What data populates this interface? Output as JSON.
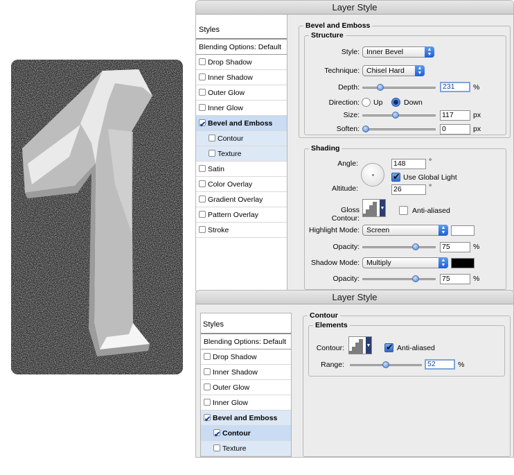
{
  "window1": {
    "title": "Layer Style",
    "sidebar": {
      "styles_label": "Styles",
      "blending_label": "Blending Options: Default",
      "items": [
        {
          "label": "Drop Shadow",
          "checked": false
        },
        {
          "label": "Inner Shadow",
          "checked": false
        },
        {
          "label": "Outer Glow",
          "checked": false
        },
        {
          "label": "Inner Glow",
          "checked": false
        },
        {
          "label": "Bevel and Emboss",
          "checked": true
        },
        {
          "label": "Contour",
          "checked": false
        },
        {
          "label": "Texture",
          "checked": false
        },
        {
          "label": "Satin",
          "checked": false
        },
        {
          "label": "Color Overlay",
          "checked": false
        },
        {
          "label": "Gradient Overlay",
          "checked": false
        },
        {
          "label": "Pattern Overlay",
          "checked": false
        },
        {
          "label": "Stroke",
          "checked": false
        }
      ]
    },
    "bevel": {
      "title": "Bevel and Emboss",
      "structure_title": "Structure",
      "style_label": "Style:",
      "style_value": "Inner Bevel",
      "technique_label": "Technique:",
      "technique_value": "Chisel Hard",
      "depth_label": "Depth:",
      "depth_value": "231",
      "depth_unit": "%",
      "depth_level": 0.22,
      "direction_label": "Direction:",
      "direction_up": "Up",
      "direction_down": "Down",
      "size_label": "Size:",
      "size_value": "117",
      "size_unit": "px",
      "size_level": 0.45,
      "soften_label": "Soften:",
      "soften_value": "0",
      "soften_unit": "px",
      "soften_level": 0.0
    },
    "shading": {
      "title": "Shading",
      "angle_label": "Angle:",
      "angle_value": "148",
      "degree": "°",
      "global_light_label": "Use Global Light",
      "altitude_label": "Altitude:",
      "altitude_value": "26",
      "gloss_label": "Gloss Contour:",
      "anti_aliased_label": "Anti-aliased",
      "highlight_label": "Highlight Mode:",
      "highlight_value": "Screen",
      "highlight_color": "#ffffff",
      "opacity_label": "Opacity:",
      "highlight_opacity": "75",
      "highlight_opacity_level": 0.75,
      "shadow_label": "Shadow Mode:",
      "shadow_value": "Multiply",
      "shadow_color": "#000000",
      "shadow_opacity": "75",
      "shadow_opacity_level": 0.75,
      "percent": "%"
    }
  },
  "window2": {
    "title": "Layer Style",
    "sidebar": {
      "styles_label": "Styles",
      "blending_label": "Blending Options: Default",
      "items": [
        {
          "label": "Drop Shadow",
          "checked": false
        },
        {
          "label": "Inner Shadow",
          "checked": false
        },
        {
          "label": "Outer Glow",
          "checked": false
        },
        {
          "label": "Inner Glow",
          "checked": false
        },
        {
          "label": "Bevel and Emboss",
          "checked": true
        },
        {
          "label": "Contour",
          "checked": true
        },
        {
          "label": "Texture",
          "checked": false
        }
      ]
    },
    "contour": {
      "title": "Contour",
      "elements_title": "Elements",
      "contour_label": "Contour:",
      "anti_aliased_label": "Anti-aliased",
      "range_label": "Range:",
      "range_value": "52",
      "range_unit": "%",
      "range_level": 0.5
    }
  }
}
